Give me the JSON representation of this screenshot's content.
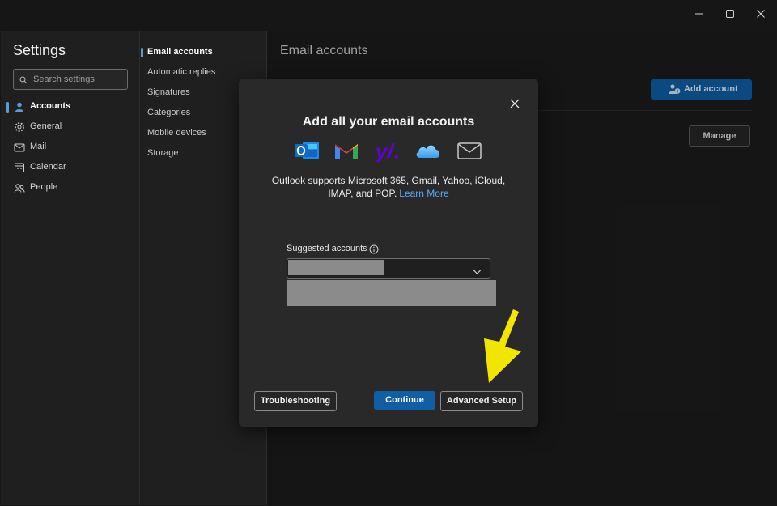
{
  "window": {
    "minimize_glyph": "—",
    "maximize_glyph": "☐",
    "close_glyph": "✕"
  },
  "settings": {
    "title": "Settings",
    "search_placeholder": "Search settings",
    "nav": [
      {
        "label": "Accounts",
        "icon": "person-icon",
        "active": true
      },
      {
        "label": "General",
        "icon": "gear-icon"
      },
      {
        "label": "Mail",
        "icon": "mail-icon"
      },
      {
        "label": "Calendar",
        "icon": "calendar-icon"
      },
      {
        "label": "People",
        "icon": "people-icon"
      }
    ]
  },
  "accounts_subnav": [
    {
      "label": "Email accounts",
      "active": true
    },
    {
      "label": "Automatic replies"
    },
    {
      "label": "Signatures"
    },
    {
      "label": "Categories"
    },
    {
      "label": "Mobile devices"
    },
    {
      "label": "Storage"
    }
  ],
  "main": {
    "title": "Email accounts",
    "add_account_label": "Add account",
    "manage_label": "Manage"
  },
  "dialog": {
    "title": "Add all your email accounts",
    "providers": [
      "outlook-icon",
      "gmail-icon",
      "yahoo-icon",
      "icloud-icon",
      "generic-mail-icon"
    ],
    "support_text": "Outlook supports Microsoft 365, Gmail, Yahoo, iCloud, IMAP, and POP.",
    "learn_more": "Learn More",
    "suggested_label": "Suggested accounts",
    "troubleshooting_label": "Troubleshooting",
    "continue_label": "Continue",
    "advanced_setup_label": "Advanced Setup"
  },
  "colors": {
    "accent": "#0f5ea6",
    "link": "#5aa9f0",
    "annotation_arrow": "#f2e600",
    "redaction": "#8b8b8b"
  }
}
